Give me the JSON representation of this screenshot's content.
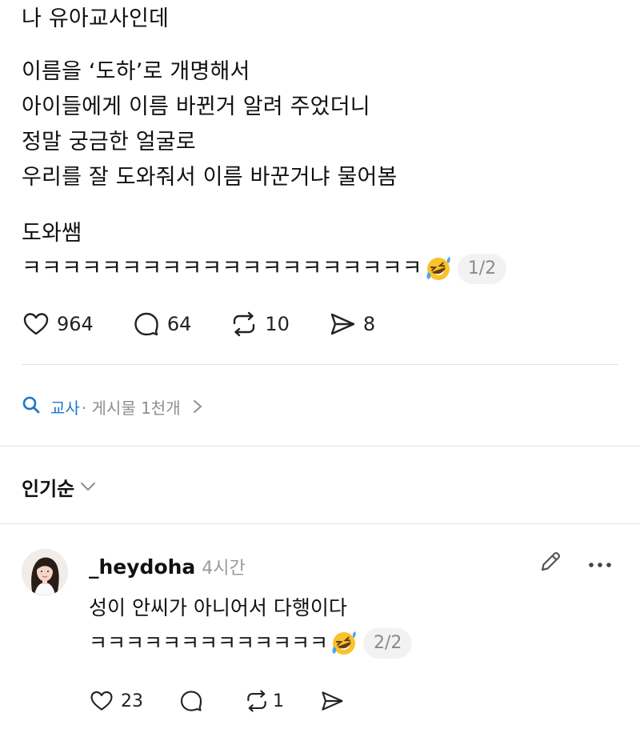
{
  "post": {
    "paragraph1": [
      "나 유아교사인데"
    ],
    "paragraph2": [
      "이름을 ‘도하’로 개명해서",
      "아이들에게 이름 바뀐거 알려 주었더니",
      "정말 궁금한 얼굴로",
      "우리를 잘 도와줘서 이름 바꾼거냐 물어봄"
    ],
    "paragraph3_line1": "도와쌤",
    "laugh_text": "ㅋㅋㅋㅋㅋㅋㅋㅋㅋㅋㅋㅋㅋㅋㅋㅋㅋㅋㅋㅋ",
    "emoji": "rolling-on-floor-laughing-emoji",
    "page_badge": "1/2"
  },
  "post_actions": {
    "likes": "964",
    "replies": "64",
    "reposts": "10",
    "shares": "8"
  },
  "topic": {
    "name": "교사",
    "meta": "· 게시물 1천개"
  },
  "sort": {
    "label": "인기순"
  },
  "comment": {
    "username": "_heydoha",
    "time": "4시간",
    "line1": "성이 안씨가 아니어서 다행이다",
    "laugh_text": "ㅋㅋㅋㅋㅋㅋㅋㅋㅋㅋㅋㅋㅋ",
    "page_badge": "2/2",
    "likes": "23",
    "reposts": "1"
  },
  "colors": {
    "accent": "#1d77c7",
    "muted": "#8e8e8e",
    "divider": "#e3e3e3",
    "badge_bg": "#f2f2f2"
  }
}
